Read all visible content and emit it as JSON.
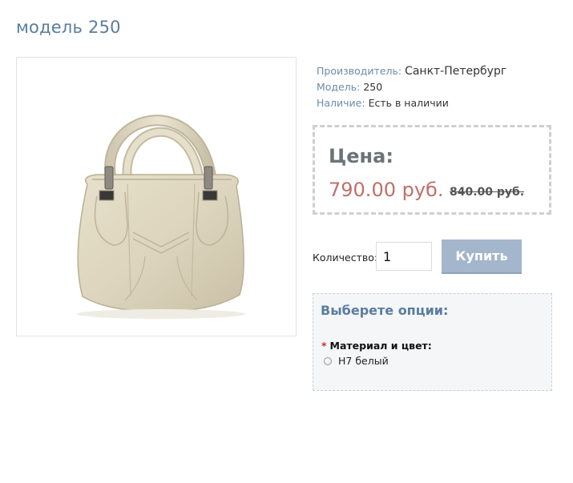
{
  "product": {
    "title": "модель 250",
    "image_alt": "product-bag-image"
  },
  "info": {
    "manufacturer_label": "Производитель:",
    "manufacturer_value": "Санкт-Петербург",
    "model_label": "Модель:",
    "model_value": "250",
    "availability_label": "Наличие:",
    "availability_value": "Есть в наличии"
  },
  "price": {
    "label": "Цена:",
    "new": "790.00 руб.",
    "old": "840.00 руб."
  },
  "cart": {
    "quantity_label": "Количество:",
    "quantity_value": "1",
    "buy_label": "Купить"
  },
  "options": {
    "title": "Выберете опции:",
    "required_mark": "*",
    "option_name": "Материал и цвет:",
    "values": [
      "Н7 белый"
    ]
  },
  "colors": {
    "title": "#5a7da0",
    "price_new": "#c0706a",
    "buy_button": "#a3b6cc"
  }
}
